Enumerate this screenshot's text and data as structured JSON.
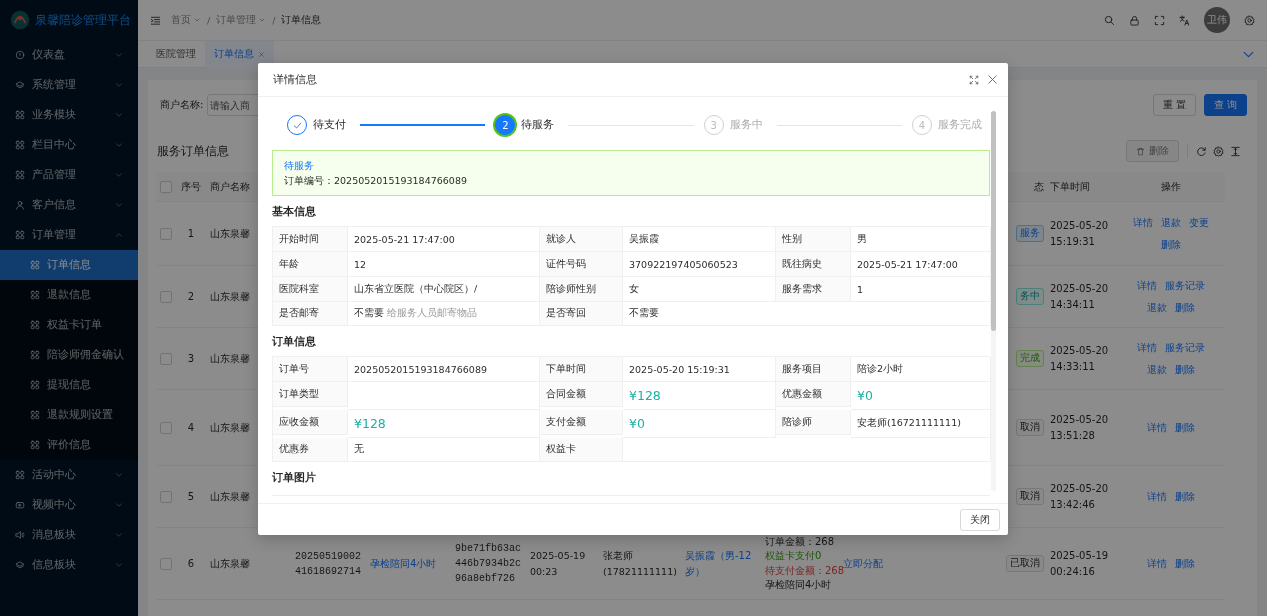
{
  "sidebar": {
    "title": "泉馨陪诊管理平台",
    "items": [
      {
        "label": "仪表盘",
        "kind": "dashboard",
        "expanded": false
      },
      {
        "label": "系统管理",
        "kind": "layers",
        "expanded": false
      },
      {
        "label": "业务模块",
        "kind": "grid",
        "expanded": false
      },
      {
        "label": "栏目中心",
        "kind": "grid",
        "expanded": false
      },
      {
        "label": "产品管理",
        "kind": "grid",
        "expanded": false
      },
      {
        "label": "客户信息",
        "kind": "user",
        "expanded": false
      },
      {
        "label": "订单管理",
        "kind": "grid",
        "expanded": true,
        "children": [
          {
            "label": "订单信息",
            "selected": true
          },
          {
            "label": "退款信息",
            "selected": false
          },
          {
            "label": "权益卡订单",
            "selected": false
          },
          {
            "label": "陪诊师佣金确认",
            "selected": false
          },
          {
            "label": "提现信息",
            "selected": false
          },
          {
            "label": "退款规则设置",
            "selected": false
          },
          {
            "label": "评价信息",
            "selected": false
          }
        ]
      },
      {
        "label": "活动中心",
        "kind": "grid",
        "expanded": false
      },
      {
        "label": "视频中心",
        "kind": "video",
        "expanded": false
      },
      {
        "label": "消息板块",
        "kind": "sound",
        "expanded": false
      },
      {
        "label": "信息板块",
        "kind": "layers",
        "expanded": false
      }
    ]
  },
  "header": {
    "breadcrumb": {
      "separator": "/",
      "items": [
        {
          "label": "首页",
          "dropdown": true
        },
        {
          "label": "订单管理",
          "dropdown": true
        },
        {
          "label": "订单信息",
          "dropdown": false
        }
      ]
    },
    "avatar_text": "卫伟"
  },
  "tabs": [
    {
      "label": "医院管理",
      "selected": false,
      "closable": false
    },
    {
      "label": "订单信息",
      "selected": true,
      "closable": true
    }
  ],
  "search": {
    "label": "商户名称:",
    "placeholder": "请输入商",
    "buttons": [
      {
        "label": "重 置",
        "kind": "default"
      },
      {
        "label": "查 询",
        "kind": "primary"
      }
    ]
  },
  "table": {
    "title": "服务订单信息",
    "delete_button": {
      "label": "删除",
      "disabled": true
    },
    "header_checked": false,
    "columns": {
      "index": "序号",
      "merchant": "商户名称",
      "status": "态",
      "time": "下单时间",
      "actions": "操作"
    },
    "rows": [
      {
        "checked": false,
        "index": "1",
        "merchant": "山东泉馨",
        "status": {
          "label": "服务",
          "kind": "pending"
        },
        "time": "2025-05-20 15:19:31",
        "action_lines": [
          [
            "详情",
            "退款",
            "变更"
          ],
          [
            "删除"
          ]
        ]
      },
      {
        "checked": false,
        "index": "2",
        "merchant": "山东泉馨",
        "status": {
          "label": "务中",
          "kind": "in_service"
        },
        "time": "2025-05-20 14:34:11",
        "action_lines": [
          [
            "详情",
            "服务记录"
          ],
          [
            "退款",
            "删除"
          ]
        ]
      },
      {
        "checked": false,
        "index": "3",
        "merchant": "山东泉馨",
        "status": {
          "label": "完成",
          "kind": "done"
        },
        "time": "2025-05-20 14:33:11",
        "action_lines": [
          [
            "详情",
            "服务记录"
          ],
          [
            "退款",
            "删除"
          ]
        ]
      },
      {
        "checked": false,
        "index": "4",
        "merchant": "山东泉馨",
        "status": {
          "label": "取消",
          "kind": "cancelled"
        },
        "time": "2025-05-20 13:51:28",
        "action_lines": [
          [
            "详情",
            "删除"
          ]
        ]
      },
      {
        "checked": false,
        "index": "5",
        "merchant": "山东泉馨",
        "status": {
          "label": "取消",
          "kind": "cancelled"
        },
        "time": "2025-05-20 13:42:46",
        "action_lines": [
          [
            "详情",
            "删除"
          ]
        ]
      },
      {
        "checked": false,
        "index": "6",
        "merchant": "山东泉馨",
        "status": {
          "label": "已取消",
          "kind": "cancelled"
        },
        "time": "2025-05-19 00:24:16",
        "action_lines": [
          [
            "详情",
            "删除"
          ]
        ],
        "extra_cells": [
          {
            "kind": "code",
            "text": "2025051900241618692714"
          },
          {
            "kind": "link",
            "text": "孕检陪同4小时"
          },
          {
            "kind": "code",
            "text": "9be71fb63ac446b7934b2c96a8ebf726"
          },
          {
            "kind": "text",
            "text": "2025-05-19 00:23"
          },
          {
            "kind": "text",
            "text": "张老师 (17821111111)"
          },
          {
            "kind": "link",
            "text": "吴振霞（男-12岁）"
          },
          {
            "kind": "lines",
            "lines": [
              {
                "text": "订单金额：268",
                "kind": "plain"
              },
              {
                "text": "权益卡支付0",
                "kind": "paid"
              },
              {
                "text": "待支付金额：268",
                "kind": "due"
              },
              {
                "text": "孕检陪同4小时",
                "kind": "plain"
              }
            ]
          },
          {
            "kind": "link",
            "text": "立即分配"
          }
        ]
      }
    ]
  },
  "dialog": {
    "title": "详情信息",
    "steps": [
      {
        "label": "待支付",
        "kind": "finish"
      },
      {
        "number": "2",
        "label": "待服务",
        "kind": "process"
      },
      {
        "number": "3",
        "label": "服务中",
        "kind": "wait"
      },
      {
        "number": "4",
        "label": "服务完成",
        "kind": "wait"
      }
    ],
    "alert": {
      "title": "待服务",
      "text": "订单编号：2025052015193184766089"
    },
    "sections": [
      {
        "title": "基本信息",
        "kind": "descriptions",
        "rows": [
          [
            {
              "label": "开始时间",
              "value": "2025-05-21 17:47:00"
            },
            {
              "label": "就诊人",
              "value": "吴振霞"
            },
            {
              "label": "性别",
              "value": "男"
            }
          ],
          [
            {
              "label": "年龄",
              "value": "12"
            },
            {
              "label": "证件号码",
              "value": "370922197405060523"
            },
            {
              "label": "既往病史",
              "value": "2025-05-21 17:47:00"
            }
          ],
          [
            {
              "label": "医院科室",
              "value": "山东省立医院（中心院区）/"
            },
            {
              "label": "陪诊师性别",
              "value": "女"
            },
            {
              "label": "服务需求",
              "value": "1"
            }
          ],
          [
            {
              "label": "是否邮寄",
              "value": "不需要",
              "note": "给服务人员邮寄物品"
            },
            {
              "label": "是否寄回",
              "value": "不需要"
            }
          ]
        ]
      },
      {
        "title": "订单信息",
        "kind": "descriptions",
        "rows": [
          [
            {
              "label": "订单号",
              "value": "2025052015193184766089"
            },
            {
              "label": "下单时间",
              "value": "2025-05-20 15:19:31"
            },
            {
              "label": "服务项目",
              "value": "陪诊2小时"
            }
          ],
          [
            {
              "label": "订单类型"
            },
            {
              "label": "合同金额",
              "value": "¥128",
              "kind": "money"
            },
            {
              "label": "优惠金额",
              "value": "¥0",
              "kind": "money"
            }
          ],
          [
            {
              "label": "应收金额",
              "value": "¥128",
              "kind": "money"
            },
            {
              "label": "支付金额",
              "value": "¥0",
              "kind": "money"
            },
            {
              "label": "陪诊师",
              "value": "安老师(16721111111)"
            }
          ],
          [
            {
              "label": "优惠券",
              "value": "无"
            },
            {
              "label": "权益卡"
            }
          ]
        ]
      },
      {
        "title": "订单图片",
        "kind": "images"
      }
    ],
    "footer_button": "关闭"
  }
}
